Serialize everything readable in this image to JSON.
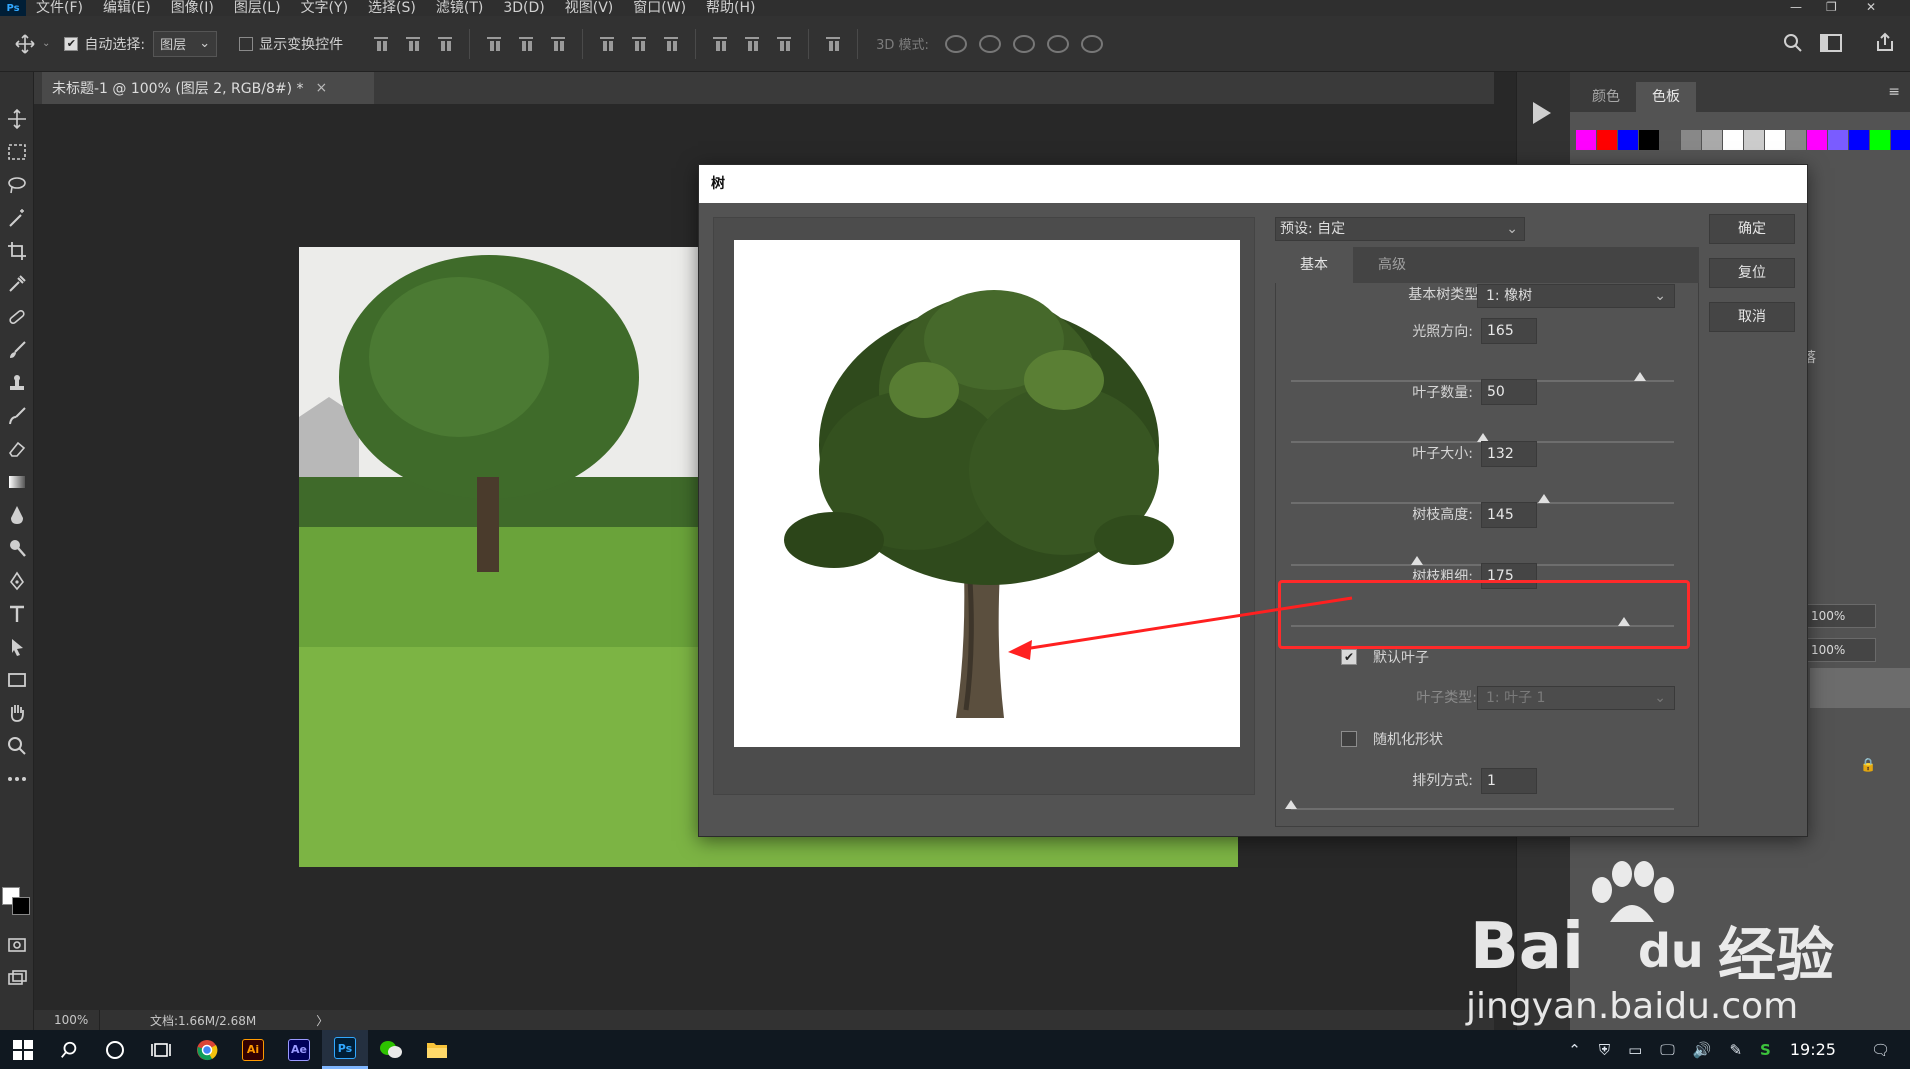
{
  "menubar": {
    "logo": "Ps",
    "items": [
      "文件(F)",
      "编辑(E)",
      "图像(I)",
      "图层(L)",
      "文字(Y)",
      "选择(S)",
      "滤镜(T)",
      "3D(D)",
      "视图(V)",
      "窗口(W)",
      "帮助(H)"
    ]
  },
  "options": {
    "auto_select_label": "自动选择:",
    "auto_select_value": "图层",
    "show_transform_label": "显示变换控件",
    "mode3d_label": "3D 模式:"
  },
  "document": {
    "tab_title": "未标题-1 @ 100% (图层 2, RGB/8#) *",
    "close_glyph": "×"
  },
  "status": {
    "zoom": "100%",
    "doc_size": "文档:1.66M/2.68M",
    "arrow": "〉"
  },
  "panels": {
    "tab_color": "颜色",
    "tab_swatches": "色板",
    "swatches": [
      "#ff00ff",
      "#ff0000",
      "#0000ff",
      "#000000",
      "#555555",
      "#888888",
      "#aaaaaa",
      "#ffffff",
      "#cccccc",
      "#ffffff",
      "#888888",
      "#ff00ff",
      "#7a5cff",
      "#0000ff",
      "#00ff00",
      "#0000ff"
    ],
    "paragraph_label": "落",
    "opacity_1": "100%",
    "opacity_2": "100%"
  },
  "dialog": {
    "title": "树",
    "preset_label": "预设: 自定",
    "tab_basic": "基本",
    "tab_advanced": "高级",
    "base_type_label": "基本树类型:",
    "base_type_value": "1: 橡树",
    "light_direction_label": "光照方向:",
    "light_direction_value": "165",
    "light_direction_pct": 0.91,
    "leaf_count_label": "叶子数量:",
    "leaf_count_value": "50",
    "leaf_count_pct": 0.5,
    "leaf_size_label": "叶子大小:",
    "leaf_size_value": "132",
    "leaf_size_pct": 0.66,
    "branch_height_label": "树枝高度:",
    "branch_height_value": "145",
    "branch_height_pct": 0.33,
    "branch_thickness_label": "树枝粗细:",
    "branch_thickness_value": "175",
    "branch_thickness_pct": 0.87,
    "default_leaves_label": "默认叶子",
    "leaf_type_label": "叶子类型:",
    "leaf_type_value": "1: 叶子 1",
    "randomize_label": "随机化形状",
    "arrangement_label": "排列方式:",
    "arrangement_value": "1",
    "arrangement_pct": 0.0,
    "ok_button": "确定",
    "reset_button": "复位",
    "cancel_button": "取消"
  },
  "taskbar": {
    "clock": "19:25",
    "apps": [
      "Ai",
      "Ae",
      "Ps"
    ]
  },
  "watermark": {
    "brand": "Bai",
    "brand_suffix": "du",
    "cn": "经验",
    "url": "jingyan.baidu.com"
  },
  "colors": {
    "highlight": "#ff2a2a",
    "accent": "#31a8ff"
  }
}
